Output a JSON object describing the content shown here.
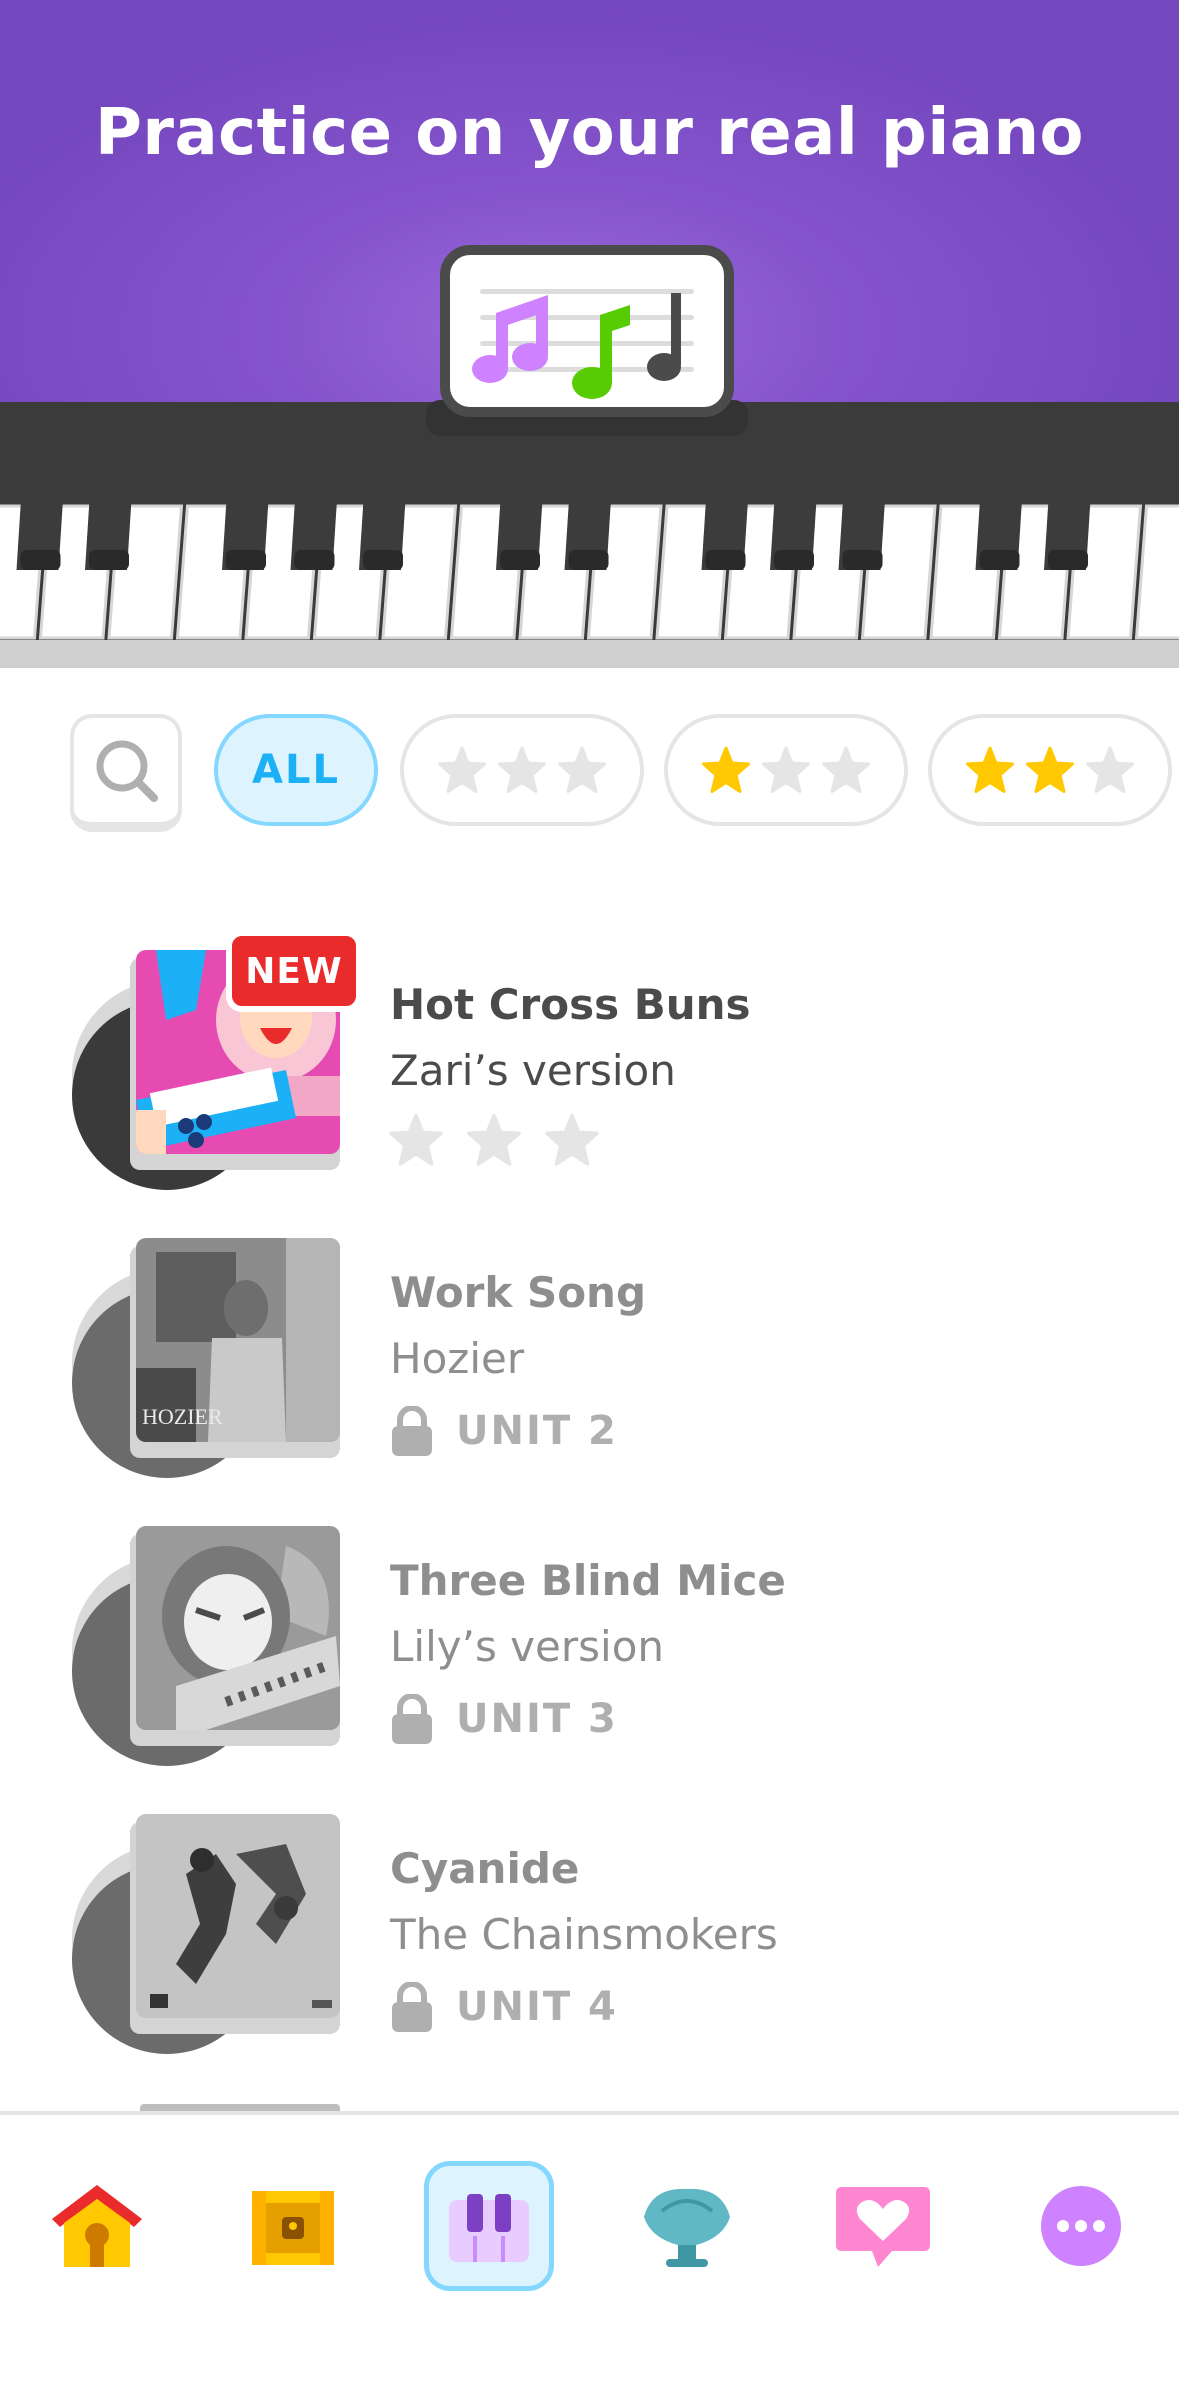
{
  "header": {
    "title": "Practice on your real piano"
  },
  "filters": {
    "search_icon": "search-icon",
    "all_label": "ALL",
    "options": [
      {
        "label": "ALL",
        "stars_filled": 0,
        "active": true
      },
      {
        "stars_filled": 0,
        "stars_total": 3,
        "active": false
      },
      {
        "stars_filled": 1,
        "stars_total": 3,
        "active": false
      },
      {
        "stars_filled": 2,
        "stars_total": 3,
        "active": false
      }
    ]
  },
  "songs": [
    {
      "title": "Hot Cross Buns",
      "subtitle": "Zari’s version",
      "badge": "NEW",
      "stars_earned": 0,
      "stars_total": 3,
      "locked": false
    },
    {
      "title": "Work Song",
      "subtitle": "Hozier",
      "lock_label": "UNIT 2",
      "locked": true,
      "cover_text": "HOZIER"
    },
    {
      "title": "Three Blind Mice",
      "subtitle": "Lily’s version",
      "lock_label": "UNIT 3",
      "locked": true
    },
    {
      "title": "Cyanide",
      "subtitle": "The Chainsmokers",
      "lock_label": "UNIT 4",
      "locked": true
    }
  ],
  "nav": {
    "items": [
      {
        "icon": "home-icon",
        "active": false
      },
      {
        "icon": "treasure-icon",
        "active": false
      },
      {
        "icon": "piano-icon",
        "active": true
      },
      {
        "icon": "shell-icon",
        "active": false
      },
      {
        "icon": "heart-chat-icon",
        "active": false
      },
      {
        "icon": "more-icon",
        "active": false
      }
    ]
  },
  "colors": {
    "header_purple": "#7b49c4",
    "accent_blue": "#1cb0f6",
    "star_gold": "#ffc800",
    "new_red": "#ea2b2b"
  }
}
